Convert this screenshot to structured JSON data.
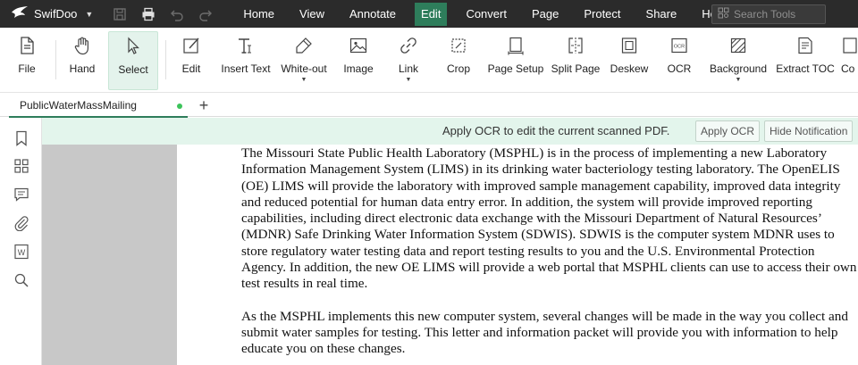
{
  "app": {
    "name": "SwifDoo"
  },
  "menubar": {
    "items": [
      "Home",
      "View",
      "Annotate",
      "Edit",
      "Convert",
      "Page",
      "Protect",
      "Share",
      "Help"
    ],
    "active": "Edit"
  },
  "search": {
    "placeholder": "Search Tools"
  },
  "toolbar": {
    "tools": [
      {
        "label": "File",
        "icon": "file-icon"
      },
      {
        "label": "Hand",
        "icon": "hand-icon"
      },
      {
        "label": "Select",
        "icon": "select-cursor-icon",
        "selected": true
      },
      {
        "label": "Edit",
        "icon": "edit-icon"
      },
      {
        "label": "Insert Text",
        "icon": "insert-text-icon"
      },
      {
        "label": "White-out",
        "icon": "white-out-icon",
        "dropdown": true
      },
      {
        "label": "Image",
        "icon": "image-icon"
      },
      {
        "label": "Link",
        "icon": "link-icon",
        "dropdown": true
      },
      {
        "label": "Crop",
        "icon": "crop-icon"
      },
      {
        "label": "Page Setup",
        "icon": "page-setup-icon"
      },
      {
        "label": "Split Page",
        "icon": "split-page-icon"
      },
      {
        "label": "Deskew",
        "icon": "deskew-icon"
      },
      {
        "label": "OCR",
        "icon": "ocr-icon"
      },
      {
        "label": "Background",
        "icon": "background-icon",
        "dropdown": true
      },
      {
        "label": "Extract TOC",
        "icon": "extract-toc-icon"
      },
      {
        "label": "Co",
        "icon": "compare-icon"
      }
    ]
  },
  "tabs": {
    "document": "PublicWaterMassMailing",
    "add": "+"
  },
  "sidebar": {
    "icons": [
      "bookmark-icon",
      "thumbnails-icon",
      "comment-icon",
      "attachment-icon",
      "word-icon",
      "search-icon"
    ]
  },
  "notification": {
    "message": "Apply OCR to edit the current scanned PDF.",
    "apply_label": "Apply OCR",
    "hide_label": "Hide Notification",
    "background": "#e3f5ec"
  },
  "document": {
    "paragraphs": [
      "The Missouri State Public Health Laboratory (MSPHL) is in the process of implementing a new Laboratory Information Management System (LIMS) in its drinking water bacteriology testing laboratory. The OpenELIS (OE) LIMS will provide the laboratory with improved sample management capability, improved data integrity and reduced potential for human data entry error. In addition, the system will provide improved reporting capabilities, including direct electronic data exchange with the Missouri Department of Natural Resources’ (MDNR) Safe Drinking Water Information System (SDWIS). SDWIS is the computer system MDNR uses to store regulatory water testing data and report testing results to you and the U.S. Environmental Protection Agency. In addition, the new OE LIMS will provide a web portal that MSPHL clients can use to access their own test results in real time.",
      "As the MSPHL implements this new computer system, several changes will be made in the way you collect and submit water samples for testing. This letter and information packet will provide you with information to help educate you on these changes."
    ]
  },
  "colors": {
    "titlebar": "#2b2b2b",
    "accent": "#2e7d5b",
    "selected_tool": "#e4f3ec",
    "page_gutter": "#c8c8c8"
  }
}
